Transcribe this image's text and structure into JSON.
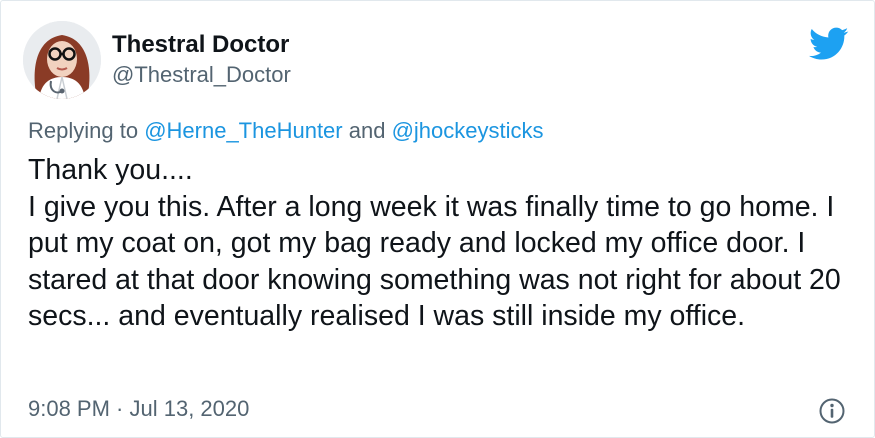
{
  "author": {
    "display_name": "Thestral Doctor",
    "handle": "@Thestral_Doctor"
  },
  "reply": {
    "prefix": "Replying to ",
    "mention1": "@Herne_TheHunter",
    "joiner": " and ",
    "mention2": "@jhockeysticks"
  },
  "tweet": {
    "text": "Thank you....\nI give you this. After a long week it was finally time to go home. I put my coat on, got my bag ready and locked my office door. I stared at that door knowing something was not right for about 20 secs... and eventually realised I was still inside my office."
  },
  "meta": {
    "time": "9:08 PM",
    "separator": " · ",
    "date": "Jul 13, 2020"
  },
  "icons": {
    "logo": "twitter-bird-icon",
    "info": "info-icon"
  },
  "colors": {
    "brand": "#1da1f2",
    "mention": "#1b95e0",
    "secondary_text": "#536471",
    "primary_text": "#0f1419"
  }
}
